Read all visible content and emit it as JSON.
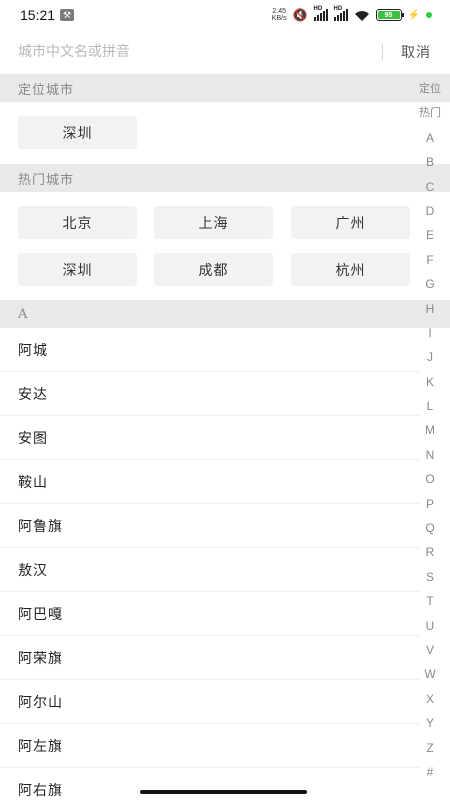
{
  "status_bar": {
    "time": "15:21",
    "network_speed_value": "2.45",
    "network_speed_unit": "KB/s",
    "hd1": "HD",
    "hd2": "HD",
    "battery": "95"
  },
  "search": {
    "placeholder": "城市中文名或拼音",
    "cancel_label": "取消"
  },
  "location_section": {
    "header": "定位城市",
    "city": "深圳"
  },
  "hot_section": {
    "header": "热门城市",
    "cities": [
      "北京",
      "上海",
      "广州",
      "深圳",
      "成都",
      "杭州"
    ]
  },
  "list_section": {
    "header": "A",
    "cities": [
      "阿城",
      "安达",
      "安图",
      "鞍山",
      "阿鲁旗",
      "敖汉",
      "阿巴嘎",
      "阿荣旗",
      "阿尔山",
      "阿左旗",
      "阿右旗"
    ]
  },
  "index_bar": [
    "定位",
    "热门",
    "A",
    "B",
    "C",
    "D",
    "E",
    "F",
    "G",
    "H",
    "I",
    "J",
    "K",
    "L",
    "M",
    "N",
    "O",
    "P",
    "Q",
    "R",
    "S",
    "T",
    "U",
    "V",
    "W",
    "X",
    "Y",
    "Z",
    "#"
  ]
}
